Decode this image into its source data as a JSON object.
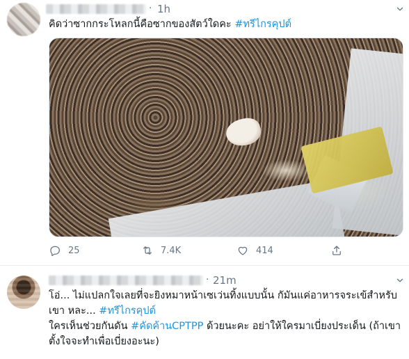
{
  "tweets": [
    {
      "time": "1h",
      "text_plain": "คิดว่าซากกระโหลกนี้คือซากของสัตว์ใดคะ ",
      "text_hashtag": "#ทรีไกรคุปต์",
      "actions": {
        "replies": "25",
        "retweets": "7.4K",
        "likes": "414"
      }
    },
    {
      "time": "21m",
      "paragraph1_plain": "โอ่... ไม่แปลกใจเลยที่จะยิงหมาหน้าเซเว่นทิ้งแบบนั้น กัมันแค่อาหารจระเข้สำหรับเขา หละ... ",
      "paragraph1_hashtag": "#ทรีไกรคุปต์",
      "paragraph2_plain_a": "ใครเห็นช่วยกันดัน ",
      "paragraph2_hashtag": "#คัดค้านCPTPP",
      "paragraph2_plain_b": " ด้วยนะคะ อย่าให้ใครมาเบี่ยงประเด็น (ถ้าเขาตั้งใจจะทำเพื่อเบี่ยงอะนะ)"
    }
  ],
  "separator": "·",
  "colors": {
    "link": "#1b95e0",
    "muted": "#657786",
    "text": "#14171a",
    "border": "#e6ecf0"
  },
  "icons": [
    "reply-icon",
    "retweet-icon",
    "like-icon",
    "share-icon",
    "chevron-down-icon"
  ]
}
